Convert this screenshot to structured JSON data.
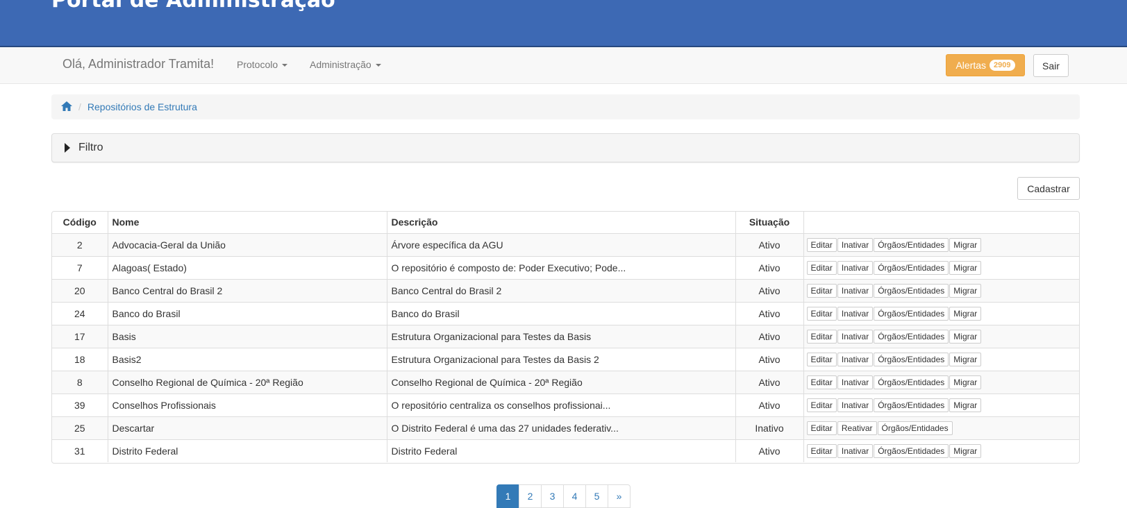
{
  "header": {
    "title": "Portal de Administração"
  },
  "navbar": {
    "greeting": "Olá, Administrador Tramita!",
    "menus": [
      "Protocolo",
      "Administração"
    ],
    "alerts_label": "Alertas",
    "alerts_count": "2909",
    "logout_label": "Sair"
  },
  "breadcrumb": {
    "home_icon": "home-icon",
    "current": "Repositórios de Estrutura"
  },
  "filter": {
    "label": "Filtro"
  },
  "register_label": "Cadastrar",
  "table": {
    "headers": [
      "Código",
      "Nome",
      "Descrição",
      "Situação",
      ""
    ],
    "rows": [
      {
        "codigo": "2",
        "nome": "Advocacia-Geral da União",
        "descricao": "Árvore específica da AGU",
        "situacao": "Ativo",
        "actions": [
          "Editar",
          "Inativar",
          "Órgãos/Entidades",
          "Migrar"
        ]
      },
      {
        "codigo": "7",
        "nome": "Alagoas( Estado)",
        "descricao": "O repositório é composto de: Poder Executivo; Pode...",
        "situacao": "Ativo",
        "actions": [
          "Editar",
          "Inativar",
          "Órgãos/Entidades",
          "Migrar"
        ]
      },
      {
        "codigo": "20",
        "nome": "Banco Central do Brasil 2",
        "descricao": "Banco Central do Brasil 2",
        "situacao": "Ativo",
        "actions": [
          "Editar",
          "Inativar",
          "Órgãos/Entidades",
          "Migrar"
        ]
      },
      {
        "codigo": "24",
        "nome": "Banco do Brasil",
        "descricao": "Banco do Brasil",
        "situacao": "Ativo",
        "actions": [
          "Editar",
          "Inativar",
          "Órgãos/Entidades",
          "Migrar"
        ]
      },
      {
        "codigo": "17",
        "nome": "Basis",
        "descricao": "Estrutura Organizacional para Testes da Basis",
        "situacao": "Ativo",
        "actions": [
          "Editar",
          "Inativar",
          "Órgãos/Entidades",
          "Migrar"
        ]
      },
      {
        "codigo": "18",
        "nome": "Basis2",
        "descricao": "Estrutura Organizacional para Testes da Basis 2",
        "situacao": "Ativo",
        "actions": [
          "Editar",
          "Inativar",
          "Órgãos/Entidades",
          "Migrar"
        ]
      },
      {
        "codigo": "8",
        "nome": "Conselho Regional de Química - 20ª Região",
        "descricao": "Conselho Regional de Química - 20ª Região",
        "situacao": "Ativo",
        "actions": [
          "Editar",
          "Inativar",
          "Órgãos/Entidades",
          "Migrar"
        ]
      },
      {
        "codigo": "39",
        "nome": "Conselhos Profissionais",
        "descricao": "O repositório centraliza os conselhos profissionai...",
        "situacao": "Ativo",
        "actions": [
          "Editar",
          "Inativar",
          "Órgãos/Entidades",
          "Migrar"
        ]
      },
      {
        "codigo": "25",
        "nome": "Descartar",
        "descricao": "O Distrito Federal é uma das 27 unidades federativ...",
        "situacao": "Inativo",
        "actions": [
          "Editar",
          "Reativar",
          "Órgãos/Entidades"
        ]
      },
      {
        "codigo": "31",
        "nome": "Distrito Federal",
        "descricao": "Distrito Federal",
        "situacao": "Ativo",
        "actions": [
          "Editar",
          "Inativar",
          "Órgãos/Entidades",
          "Migrar"
        ]
      }
    ]
  },
  "pagination": {
    "pages": [
      "1",
      "2",
      "3",
      "4",
      "5",
      "»"
    ],
    "current": "1"
  },
  "colors": {
    "banner": "#3d69b4",
    "alert": "#f0ad4e",
    "link": "#337ab7"
  }
}
